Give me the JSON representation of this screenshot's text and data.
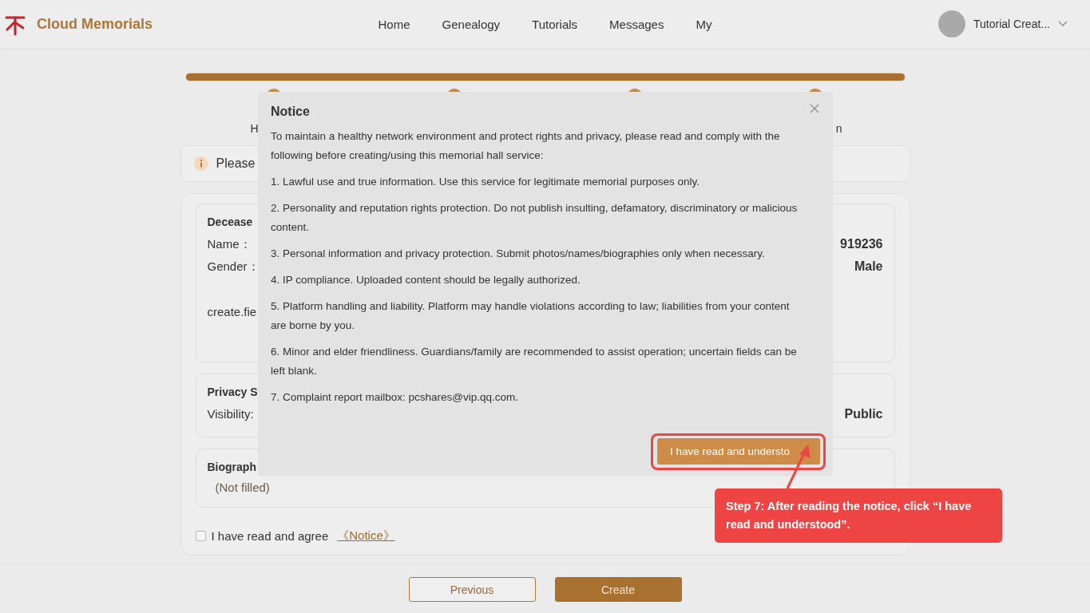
{
  "header": {
    "logo_text": "Cloud Memorials",
    "nav": [
      {
        "label": "Home"
      },
      {
        "label": "Genealogy"
      },
      {
        "label": "Tutorials"
      },
      {
        "label": "Messages"
      },
      {
        "label": "My"
      }
    ],
    "user": {
      "name": "Tutorial Creat..."
    }
  },
  "progress": {
    "level": 1,
    "labels": [
      "H",
      "n"
    ]
  },
  "info": {
    "text": "Please"
  },
  "sections": [
    {
      "title": "Decease",
      "fields": [
        {
          "label": "Name：",
          "value": "919236"
        },
        {
          "label": "Gender：",
          "value": "Male"
        },
        {
          "label": "create.fie"
        }
      ]
    },
    {
      "title": "Privacy S",
      "fields": [
        {
          "label": "Visibility:",
          "value": "Public"
        }
      ]
    },
    {
      "title": "Biograph",
      "note": "(Not filled)"
    }
  ],
  "agree": {
    "checked": false,
    "text": "I have read and agree",
    "link": "《Notice》"
  },
  "footer": {
    "buttons": [
      {
        "label": "Previous",
        "kind": "outline"
      },
      {
        "label": "Create",
        "kind": "primary"
      }
    ]
  },
  "modal": {
    "title": "Notice",
    "paragraphs": [
      "To maintain a healthy network environment and protect rights and privacy, please read and comply with the following before creating/using this memorial hall service:",
      "1. Lawful use and true information. Use this service for legitimate memorial purposes only.",
      "2. Personality and reputation rights protection. Do not publish insulting, defamatory, discriminatory or malicious content.",
      "3. Personal information and privacy protection. Submit photos/names/biographies only when necessary.",
      "4. IP compliance. Uploaded content should be legally authorized.",
      "5. Platform handling and liability. Platform may handle violations according to law; liabilities from your content are borne by you.",
      "6. Minor and elder friendliness. Guardians/family are recommended to assist operation; uncertain fields can be left blank.",
      "7. Complaint report mailbox: pcshares@vip.qq.com."
    ],
    "button": "I have read and understo"
  },
  "callout": {
    "text": "Step 7: After reading the notice, click “I have read and understood”."
  }
}
